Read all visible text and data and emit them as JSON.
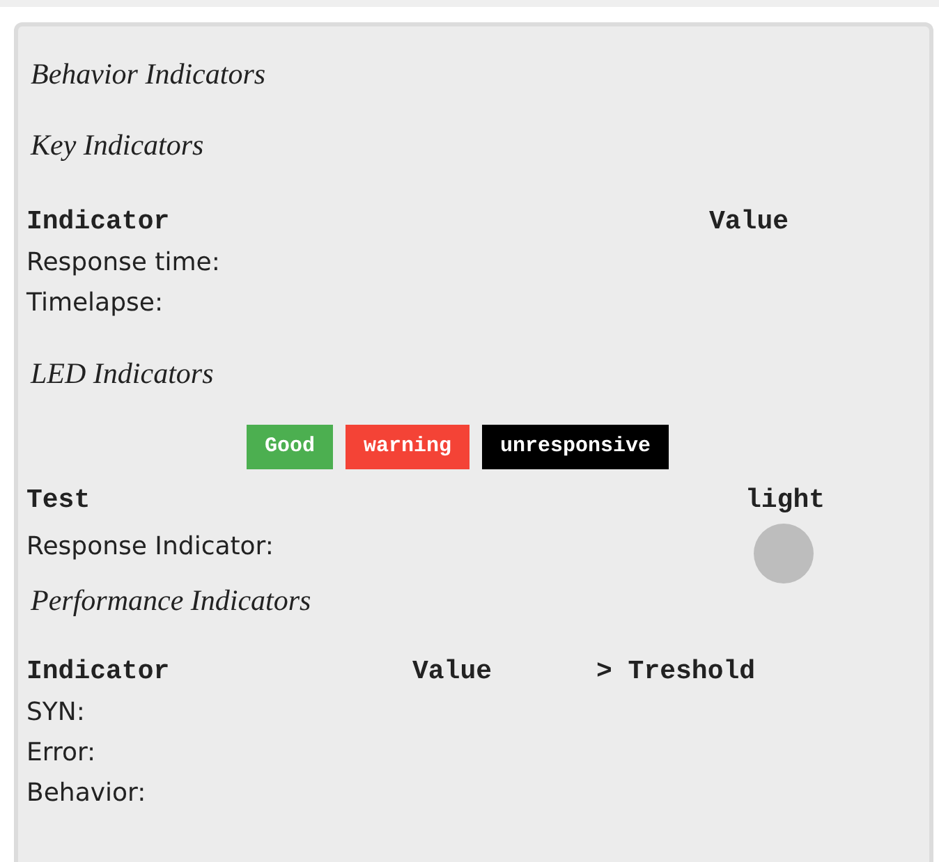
{
  "title": "Behavior Indicators",
  "key_indicators": {
    "heading": "Key Indicators",
    "columns": [
      "Indicator",
      "Value"
    ],
    "rows": [
      "Response time:",
      "Timelapse:"
    ]
  },
  "led_indicators": {
    "heading": "LED Indicators",
    "legend": [
      {
        "label": "Good",
        "color": "#4caf50"
      },
      {
        "label": "warning",
        "color": "#f44336"
      },
      {
        "label": "unresponsive",
        "color": "#000000"
      }
    ],
    "columns": [
      "Test",
      "light"
    ],
    "rows": [
      {
        "label": "Response Indicator:",
        "color": "#bdbdbd"
      }
    ]
  },
  "performance_indicators": {
    "heading": "Performance Indicators",
    "columns": [
      "Indicator",
      "Value",
      "> Treshold"
    ],
    "rows": [
      "SYN:",
      "Error:",
      "Behavior:"
    ]
  }
}
